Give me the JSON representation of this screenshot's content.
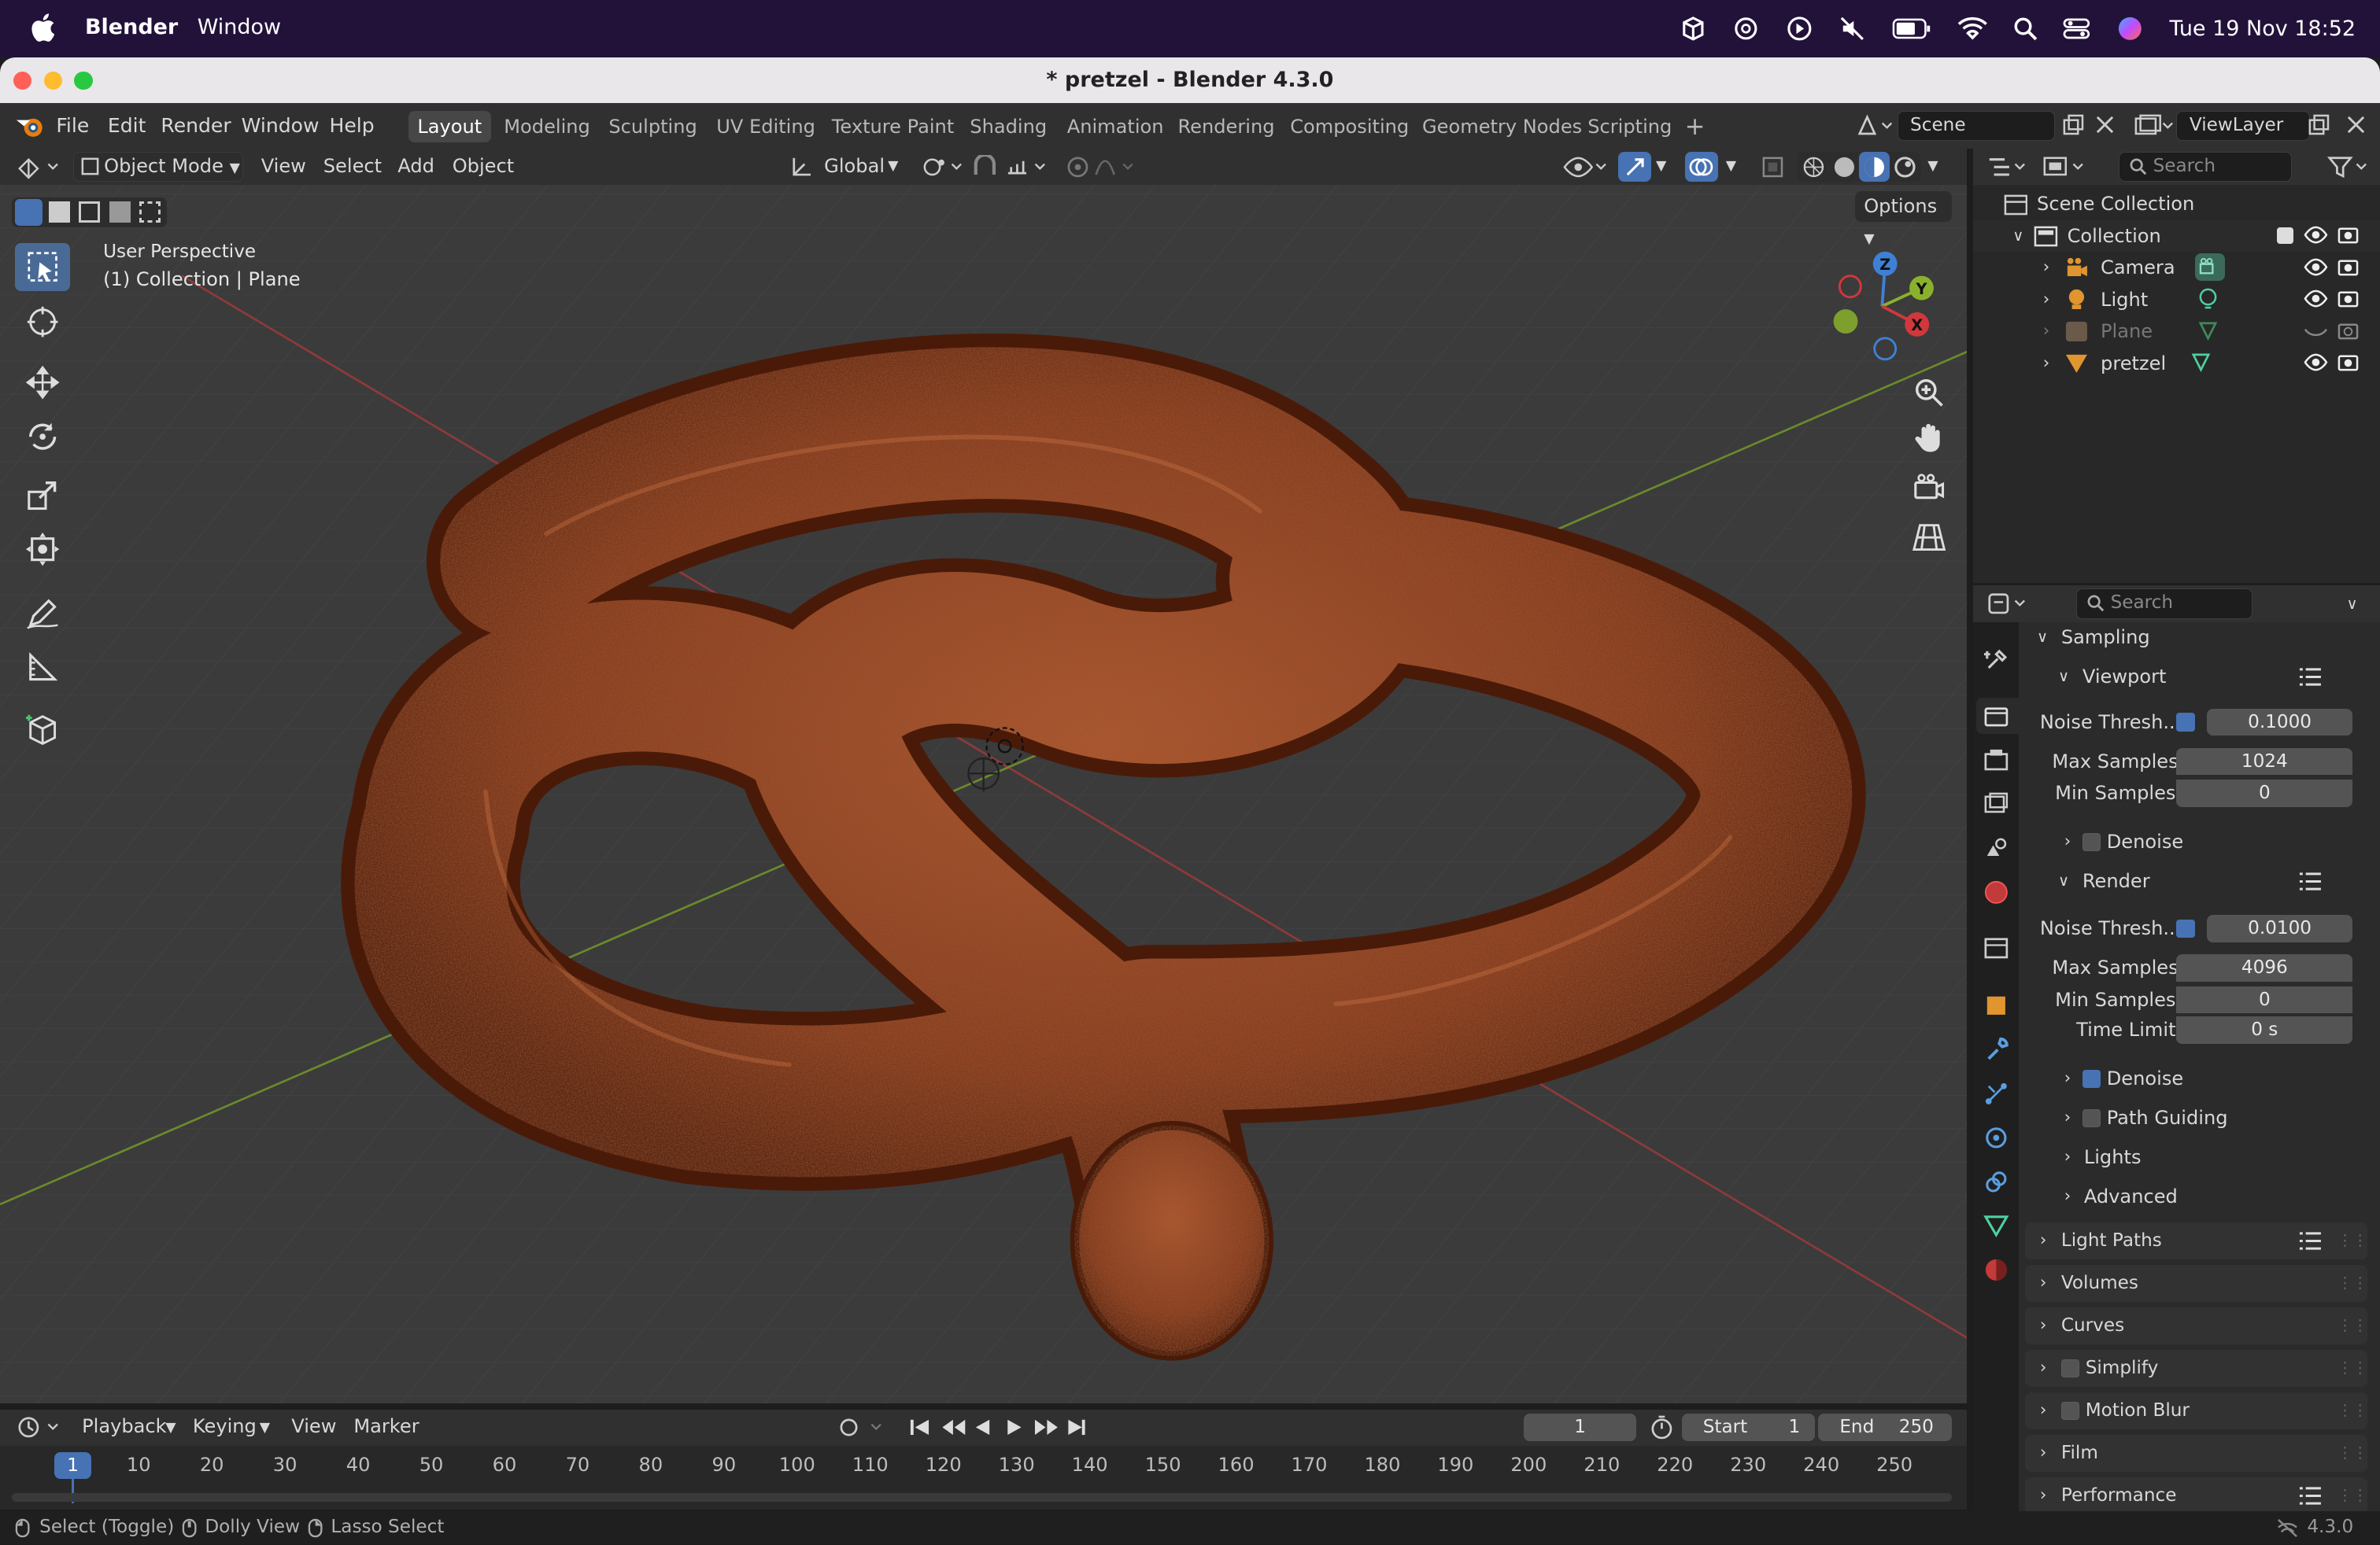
{
  "macos": {
    "app_name": "Blender",
    "menu_window": "Window",
    "clock": "Tue 19 Nov  18:52"
  },
  "window": {
    "title": "* pretzel - Blender 4.3.0"
  },
  "topbar": {
    "menus": [
      "File",
      "Edit",
      "Render",
      "Window",
      "Help"
    ],
    "workspaces": [
      "Layout",
      "Modeling",
      "Sculpting",
      "UV Editing",
      "Texture Paint",
      "Shading",
      "Animation",
      "Rendering",
      "Compositing",
      "Geometry Nodes",
      "Scripting"
    ],
    "active_workspace": "Layout",
    "add_workspace": "+",
    "scene": "Scene",
    "view_layer": "ViewLayer"
  },
  "viewport_header": {
    "mode": "Object Mode",
    "menus": [
      "View",
      "Select",
      "Add",
      "Object"
    ],
    "orientation": "Global",
    "options": "Options"
  },
  "viewport": {
    "perspective": "User Perspective",
    "context": "(1) Collection | Plane",
    "gizmo": {
      "x": "X",
      "y": "Y",
      "z": "Z"
    }
  },
  "outliner": {
    "search_placeholder": "Search",
    "root": "Scene Collection",
    "collection": "Collection",
    "items": [
      {
        "name": "Camera"
      },
      {
        "name": "Light"
      },
      {
        "name": "Plane"
      },
      {
        "name": "pretzel"
      }
    ]
  },
  "properties": {
    "search_placeholder": "Search",
    "sampling": "Sampling",
    "viewport": {
      "title": "Viewport",
      "noise_label": "Noise Thresh...",
      "noise_val": "0.1000",
      "max_label": "Max Samples",
      "max_val": "1024",
      "min_label": "Min Samples",
      "min_val": "0",
      "denoise": "Denoise"
    },
    "render": {
      "title": "Render",
      "noise_label": "Noise Thresh...",
      "noise_val": "0.0100",
      "max_label": "Max Samples",
      "max_val": "4096",
      "min_label": "Min Samples",
      "min_val": "0",
      "time_label": "Time Limit",
      "time_val": "0 s",
      "denoise": "Denoise",
      "path_guiding": "Path Guiding",
      "lights": "Lights",
      "advanced": "Advanced"
    },
    "panels": [
      "Light Paths",
      "Volumes",
      "Curves",
      "Simplify",
      "Motion Blur",
      "Film",
      "Performance"
    ]
  },
  "timeline": {
    "menus": [
      "Playback",
      "Keying",
      "View",
      "Marker"
    ],
    "current_frame": "1",
    "start_label": "Start",
    "start": "1",
    "end_label": "End",
    "end": "250",
    "ticks": [
      "1",
      "10",
      "20",
      "30",
      "40",
      "50",
      "60",
      "70",
      "80",
      "90",
      "100",
      "110",
      "120",
      "130",
      "140",
      "150",
      "160",
      "170",
      "180",
      "190",
      "200",
      "210",
      "220",
      "230",
      "240",
      "250"
    ]
  },
  "status": {
    "select": "Select (Toggle)",
    "dolly": "Dolly View",
    "lasso": "Lasso Select",
    "version": "4.3.0"
  }
}
